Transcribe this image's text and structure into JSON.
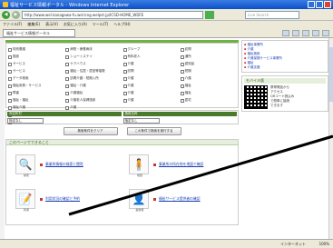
{
  "window": {
    "title": "福祉サービス情報ポータル - Windows Internet Explorer"
  },
  "address": {
    "url": "http://www.wel.kanagawa-fu.wel.kng.welpst.jp/ICSD-HOME_WDFE",
    "search_placeholder": "Live Search"
  },
  "menu": [
    "ファイル(F)",
    "編集(E)",
    "表示(V)",
    "お気に入り(A)",
    "ツール(T)",
    "ヘルプ(H)"
  ],
  "tab": {
    "label": "福祉サービス情報ポータル"
  },
  "checkboxes": [
    "特別養護",
    "病院・療養病床",
    "グループ",
    "訪問",
    "施設",
    "ショートステイ",
    "有料老人",
    "通所",
    "サービス",
    "ケアハウス",
    "介護",
    "認知症",
    "サービス",
    "福祉・住居・居室等複数",
    "訪問",
    "短期",
    "データ検索",
    "訪問介護・短期入所",
    "介護",
    "介護",
    "福祉用具・サービス",
    "福祉・介護",
    "介護",
    "福祉",
    "障害",
    "介護福祉",
    "介護",
    "福祉",
    "福祉・福祉",
    "介護老人保健施設",
    "介護",
    "居宅",
    "福祉介護",
    "介護",
    "",
    "",
    "相談・支援",
    "",
    "",
    "",
    "障害児・入所",
    "",
    "",
    ""
  ],
  "filters": [
    {
      "head": "市区町村",
      "value": "指定なし"
    },
    {
      "head": "施設名称",
      "value": "指定なし"
    }
  ],
  "buttons": {
    "left": "検索条件をクリア",
    "right": "この条件で検索を実行する"
  },
  "services": {
    "header": "このページでできること",
    "items": [
      {
        "link": "事業所情報の検索と閲覧",
        "caption": "検索"
      },
      {
        "link": "事業所の所在地を地図で確認",
        "caption": "地図"
      },
      {
        "link": "利用状況の確認と予約",
        "caption": "利用"
      },
      {
        "link": "福祉サービス提供者の確認",
        "caption": "提供者"
      }
    ]
  },
  "sidebar": {
    "links": [
      "福祉事業所",
      "介護",
      "福祉施設",
      "介護保険サービス事業所",
      "福祉",
      "介護支援"
    ],
    "mobile_head": "モバイル版",
    "mobile_text": [
      "携帯電話から",
      "アクセス",
      "QRコード読込み",
      "で簡単に接続",
      "できます"
    ]
  },
  "status": {
    "zone": "インターネット",
    "zoom": "100%"
  },
  "colors": {
    "accent_green": "#6cb33f",
    "link_blue": "#1a3fb5",
    "annotation_line": "#000000"
  }
}
